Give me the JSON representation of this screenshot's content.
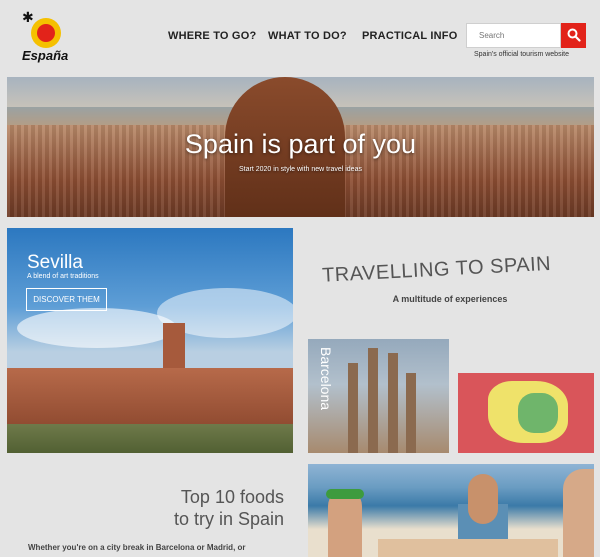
{
  "header": {
    "logo_text": "España",
    "nav": [
      "WHERE TO GO?",
      "WHAT TO DO?",
      "PRACTICAL INFO"
    ],
    "search_placeholder": "Search",
    "tagline": "Spain's official tourism website"
  },
  "hero": {
    "title": "Spain is part of you",
    "subtitle": "Start 2020 in style with new travel ideas"
  },
  "sevilla": {
    "title": "Sevilla",
    "subtitle": "A blend of art traditions",
    "button": "DISCOVER THEM"
  },
  "travelling": {
    "title": "TRAVELLING TO SPAIN",
    "subtitle": "A multitude of experiences"
  },
  "barcelona": {
    "label": "Barcelona"
  },
  "foods": {
    "title_line1": "Top 10 foods",
    "title_line2": "to try in Spain",
    "text": "Whether you're on a city break in Barcelona or Madrid, or"
  },
  "colors": {
    "accent": "#e2231a",
    "background": "#e4e4e4"
  }
}
